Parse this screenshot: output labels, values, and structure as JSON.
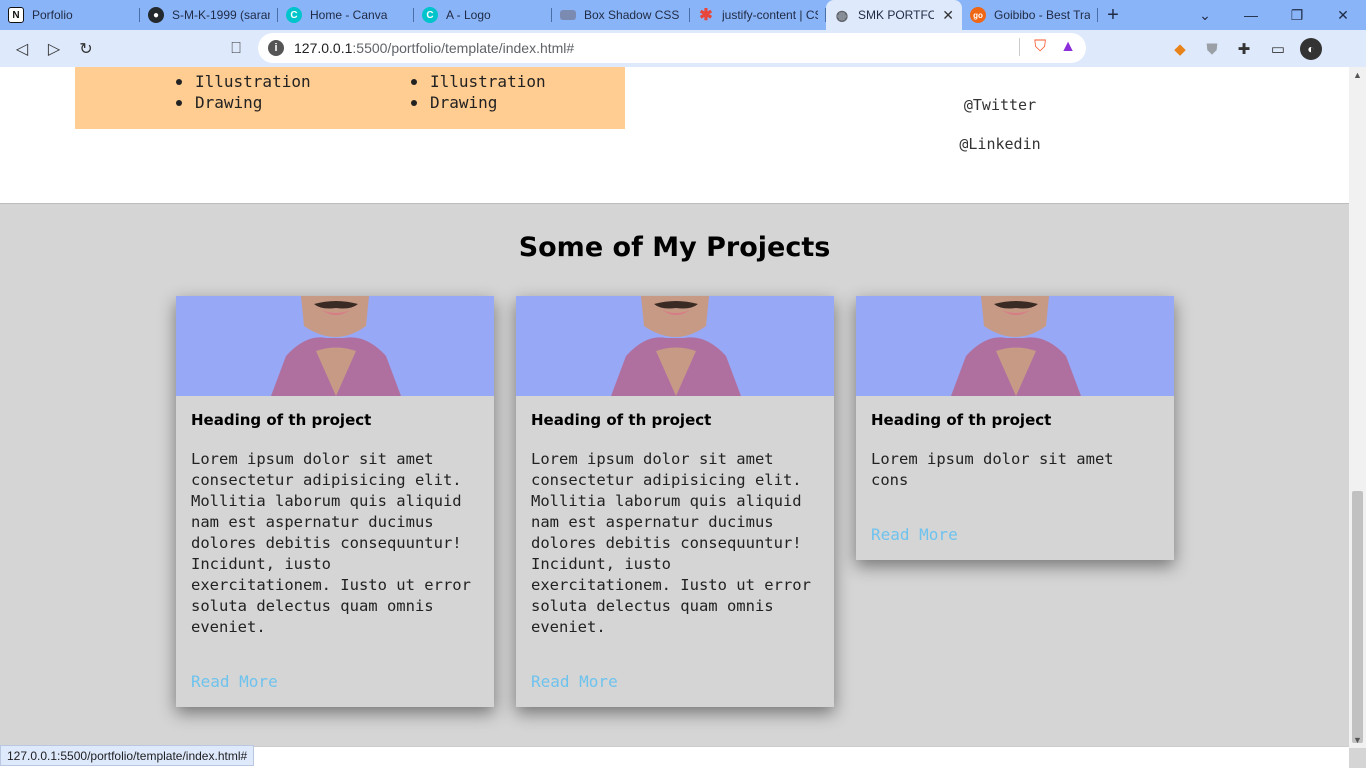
{
  "browser": {
    "tabs": [
      {
        "label": "Porfolio",
        "icon": "notion-icon",
        "color": "#111111"
      },
      {
        "label": "S-M-K-1999 (saran",
        "icon": "github-icon",
        "color": "#24292e"
      },
      {
        "label": "Home - Canva",
        "icon": "canva-icon",
        "color": "#00c4cc"
      },
      {
        "label": "A - Logo",
        "icon": "canva-icon",
        "color": "#00c4cc"
      },
      {
        "label": "Box Shadow CSS G",
        "icon": "page-icon",
        "color": "#7a8ab0"
      },
      {
        "label": "justify-content | CS",
        "icon": "star-icon",
        "color": "#e8463a"
      },
      {
        "label": "SMK PORTFOLI",
        "icon": "globe-icon",
        "color": "#5f6368"
      },
      {
        "label": "Goibibo - Best Tra",
        "icon": "goibibo-icon",
        "color": "#ef6614"
      }
    ],
    "active_tab": "SMK PORTFOLI",
    "url_host": "127.0.0.1",
    "url_path": ":5500/portfolio/template/index.html#",
    "status_url": "127.0.0.1:5500/portfolio/template/index.html#"
  },
  "skills": {
    "column1": [
      "Illustration",
      "Drawing"
    ],
    "column2": [
      "Illustration",
      "Drawing"
    ]
  },
  "social": {
    "twitter": "@Twitter",
    "linkedin": "@Linkedin"
  },
  "projects": {
    "title": "Some of My Projects",
    "cards": [
      {
        "heading": "Heading of th project",
        "text": "Lorem ipsum dolor sit amet consectetur adipisicing elit. Mollitia laborum quis aliquid nam est aspernatur ducimus dolores debitis consequuntur! Incidunt, iusto exercitationem. Iusto ut error soluta delectus quam omnis eveniet.",
        "link": "Read More"
      },
      {
        "heading": "Heading of th project",
        "text": "Lorem ipsum dolor sit amet consectetur adipisicing elit. Mollitia laborum quis aliquid nam est aspernatur ducimus dolores debitis consequuntur! Incidunt, iusto exercitationem. Iusto ut error soluta delectus quam omnis eveniet.",
        "link": "Read More"
      },
      {
        "heading": "Heading of th project",
        "text": "Lorem ipsum dolor sit amet cons",
        "link": "Read More"
      }
    ]
  },
  "colors": {
    "tab_strip": "#8ab4f8",
    "toolbar": "#dee9fb",
    "skills_box": "#ffcc91",
    "projects_bg": "#d5d5d5",
    "link": "#6ec3ee",
    "card_image_bg": "#97a8f6"
  }
}
